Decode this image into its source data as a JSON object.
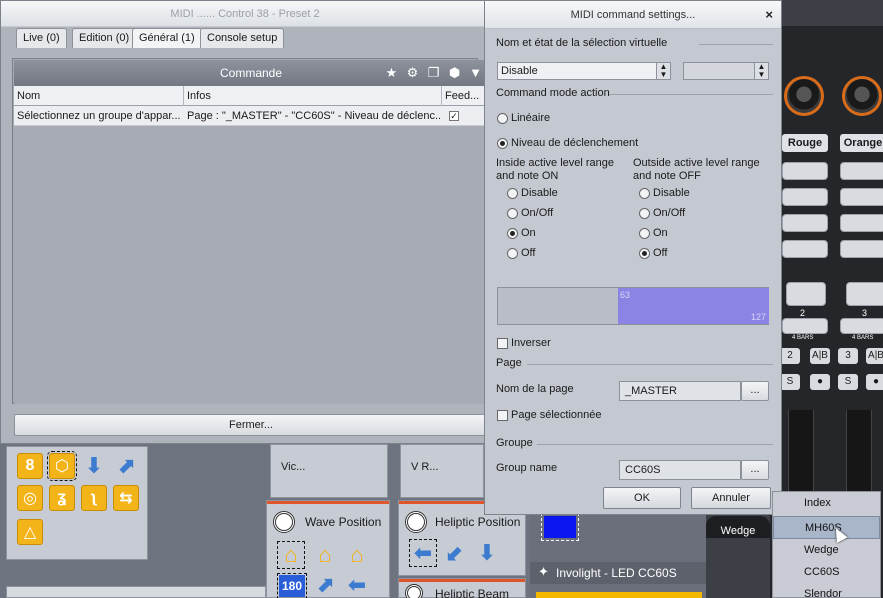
{
  "background": {
    "left_window": {
      "title": "MIDI ...... Control 38 - Preset 2",
      "tabs": [
        {
          "label": "Live (0)"
        },
        {
          "label": "Edition (0)"
        },
        {
          "label": "Général (1)"
        },
        {
          "label": "Console setup"
        }
      ],
      "commande_header": "Commande",
      "columns": [
        "Nom",
        "Infos",
        "Feed..."
      ],
      "rows": [
        {
          "nom": "Sélectionnez un groupe d'appar...",
          "infos": "Page : \"_MASTER\" - \"CC60S\" - Niveau de déclenc...",
          "feedback_checked": "✓"
        }
      ],
      "close_button": "Fermer..."
    },
    "lower_panels": {
      "vic_label": "Vic...",
      "vr_label": "V R...",
      "wave_position": "Wave Position",
      "heliptic_position": "Heliptic Position",
      "heliptic_beam": "Heliptic Beam",
      "involight": "Involight - LED CC60S",
      "wedge_label": "Wedge",
      "badge_180": "180"
    },
    "hardware": {
      "rouge": "Rouge",
      "orange": "Orange",
      "num_2": "2",
      "num_3": "3",
      "bars": "4 BARS",
      "ab": "A|B",
      "s": "S"
    }
  },
  "dialog": {
    "title": "MIDI command settings...",
    "close": "×",
    "section_virtual": "Nom et état de la sélection virtuelle",
    "virtual_select_value": "Disable",
    "section_mode": "Command mode action",
    "mode_lineaire": "Linéaire",
    "mode_niveau": "Niveau de déclenchement",
    "inside_title_1": "Inside active level range",
    "inside_title_2": "and note ON",
    "outside_title_1": "Outside active level range",
    "outside_title_2": "and note OFF",
    "options": [
      "Disable",
      "On/Off",
      "On",
      "Off"
    ],
    "inside_selected": "On",
    "outside_selected": "Off",
    "range_low": "63",
    "range_high": "127",
    "inverser": "Inverser",
    "section_page": "Page",
    "page_name_label": "Nom de la page",
    "page_name_value": "_MASTER",
    "page_selected": "Page sélectionnée",
    "section_group": "Groupe",
    "group_name_label": "Group name",
    "group_name_value": "CC60S",
    "dots": "...",
    "ok": "OK",
    "cancel": "Annuler"
  },
  "dropdown": {
    "items": [
      "Index",
      "MH60S",
      "Wedge",
      "CC60S",
      "Slendor"
    ],
    "selected": "MH60S"
  },
  "colors": {
    "range_fill": "#8b84e4",
    "accent_orange": "#e0552b",
    "tile_orange": "#f2b418"
  }
}
